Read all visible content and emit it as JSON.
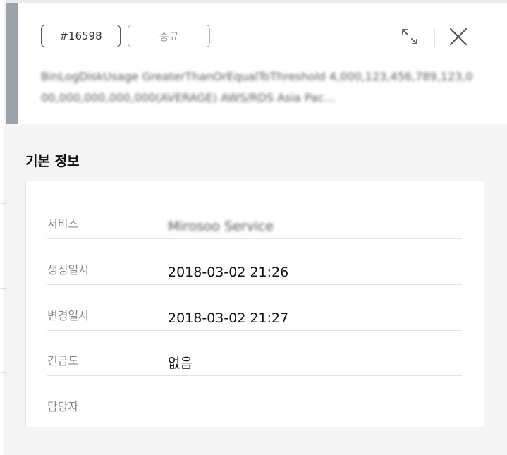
{
  "header": {
    "id_badge": "#16598",
    "status_badge": "종료",
    "title": "BinLogDiskUsage GreaterThanOrEqualToThreshold 4,000,123,456,789,123,000,000,000,000,000(AVERAGE) AWS/RDS Asia Pac…"
  },
  "section": {
    "title": "기본 정보"
  },
  "info": {
    "rows": [
      {
        "label": "서비스",
        "value": "Mirosoo Service"
      },
      {
        "label": "생성일시",
        "value": "2018-03-02 21:26"
      },
      {
        "label": "변경일시",
        "value": "2018-03-02 21:27"
      },
      {
        "label": "긴급도",
        "value": "없음"
      },
      {
        "label": "담당자",
        "value": ""
      }
    ]
  },
  "icons": {
    "expand": "expand-icon",
    "close": "close-icon"
  },
  "colors": {
    "accent": "#9aa2ab",
    "panel_bg": "#f4f4f4"
  }
}
